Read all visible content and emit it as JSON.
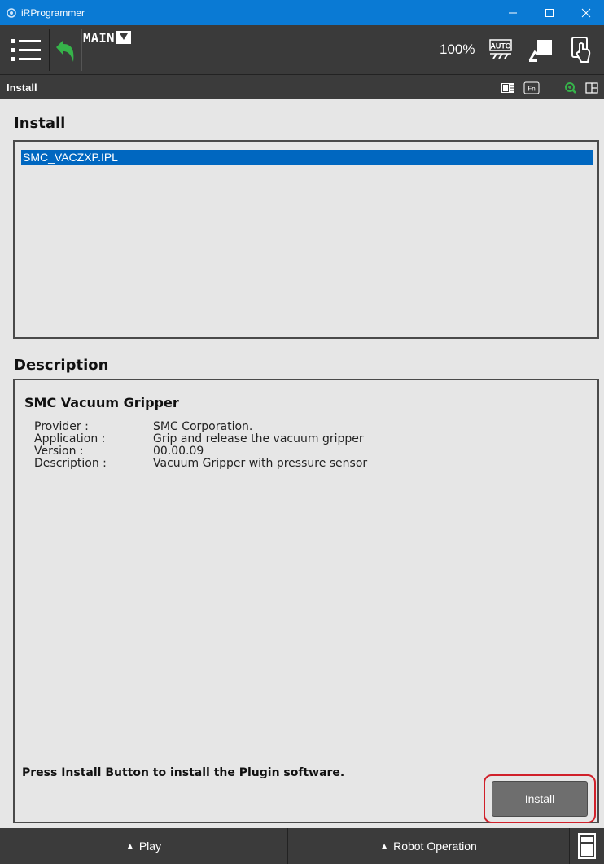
{
  "window": {
    "title": "iRProgrammer",
    "controls": [
      "minimize-icon",
      "maximize-icon",
      "close-icon"
    ]
  },
  "toolbar": {
    "program_name": "MAIN",
    "override": "100%",
    "mode_icon": "auto-mode-icon"
  },
  "screen": {
    "title": "Install"
  },
  "install_section": {
    "title": "Install",
    "items": [
      "SMC_VACZXP.IPL"
    ],
    "selected_index": 0
  },
  "description_section": {
    "title": "Description",
    "plugin_name": "SMC Vacuum Gripper",
    "fields": [
      {
        "key": "Provider :",
        "value": "SMC Corporation."
      },
      {
        "key": "Application :",
        "value": "Grip and release the vacuum gripper"
      },
      {
        "key": "Version :",
        "value": "00.00.09"
      },
      {
        "key": "Description :",
        "value": "Vacuum Gripper with pressure sensor"
      }
    ],
    "hint": "Press Install Button to install the Plugin software.",
    "install_button": "Install"
  },
  "bottom_bar": {
    "play_label": "Play",
    "robot_operation_label": "Robot Operation",
    "arrow": "▲"
  },
  "colors": {
    "titlebar": "#0a7ad4",
    "toolbar": "#3a3a3a",
    "selection": "#0067c0",
    "highlight_border": "#d0202a",
    "button": "#6e6e6e"
  }
}
